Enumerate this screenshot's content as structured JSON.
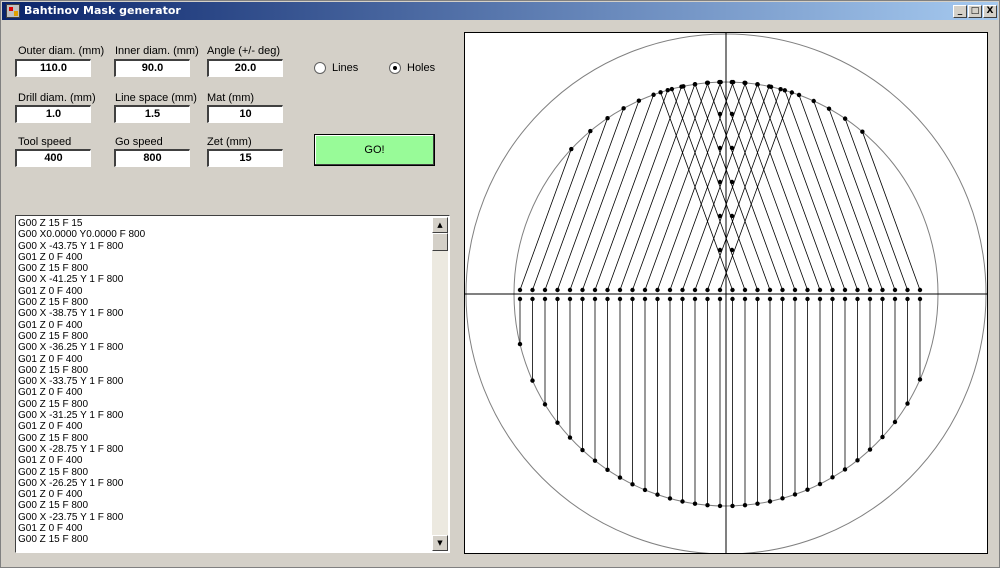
{
  "window": {
    "title": "Bahtinov Mask generator",
    "minimize": "_",
    "maximize": "□",
    "close": "X"
  },
  "params": {
    "outer_diam": {
      "label": "Outer diam. (mm)",
      "value": "110.0"
    },
    "inner_diam": {
      "label": "Inner diam. (mm)",
      "value": "90.0"
    },
    "angle": {
      "label": "Angle (+/- deg)",
      "value": "20.0"
    },
    "drill_diam": {
      "label": "Drill diam. (mm)",
      "value": "1.0"
    },
    "line_space": {
      "label": "Line space (mm)",
      "value": "1.5"
    },
    "mat": {
      "label": "Mat (mm)",
      "value": "10"
    },
    "tool_speed": {
      "label": "Tool speed",
      "value": "400"
    },
    "go_speed": {
      "label": "Go speed",
      "value": "800"
    },
    "zet": {
      "label": "Zet (mm)",
      "value": "15"
    }
  },
  "mode": {
    "lines_label": "Lines",
    "holes_label": "Holes",
    "selected": "Holes"
  },
  "go_button": "GO!",
  "gcode_lines": [
    "G00 Z 15 F 15",
    "G00 X0.0000 Y0.0000 F 800",
    "G00 X -43.75 Y 1 F 800",
    "G01 Z 0 F 400",
    "G00 Z 15 F 800",
    "G00 X -41.25 Y 1 F 800",
    "G01 Z 0 F 400",
    "G00 Z 15 F 800",
    "G00 X -38.75 Y 1 F 800",
    "G01 Z 0 F 400",
    "G00 Z 15 F 800",
    "G00 X -36.25 Y 1 F 800",
    "G01 Z 0 F 400",
    "G00 Z 15 F 800",
    "G00 X -33.75 Y 1 F 800",
    "G01 Z 0 F 400",
    "G00 Z 15 F 800",
    "G00 X -31.25 Y 1 F 800",
    "G01 Z 0 F 400",
    "G00 Z 15 F 800",
    "G00 X -28.75 Y 1 F 800",
    "G01 Z 0 F 400",
    "G00 Z 15 F 800",
    "G00 X -26.25 Y 1 F 800",
    "G01 Z 0 F 400",
    "G00 Z 15 F 800",
    "G00 X -23.75 Y 1 F 800",
    "G01 Z 0 F 400",
    "G00 Z 15 F 800"
  ],
  "scrollbar": {
    "up_icon": "triangle-up-icon",
    "down_icon": "triangle-down-icon"
  },
  "preview": {
    "description_icon": "bahtinov-mask-preview",
    "colors": {
      "line": "#000000",
      "outer_circle": "#808080",
      "axes": "#000000"
    }
  }
}
